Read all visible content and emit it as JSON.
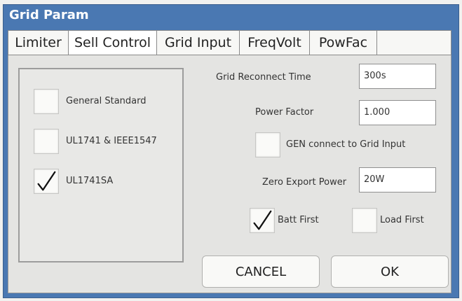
{
  "window": {
    "title": "Grid Param"
  },
  "tabs": [
    {
      "label": "Limiter",
      "active": false
    },
    {
      "label": "Sell Control",
      "active": true
    },
    {
      "label": "Grid Input",
      "active": false
    },
    {
      "label": "FreqVolt",
      "active": false
    },
    {
      "label": "PowFac",
      "active": false
    }
  ],
  "standards": [
    {
      "label": "General Standard",
      "checked": false
    },
    {
      "label": "UL1741 & IEEE1547",
      "checked": false
    },
    {
      "label": "UL1741SA",
      "checked": true
    }
  ],
  "settings": {
    "reconnect_label": "Grid Reconnect Time",
    "reconnect_value": "300s",
    "power_factor_label": "Power Factor",
    "power_factor_value": "1.000",
    "gen_connect_label": "GEN connect to Grid Input",
    "gen_connect_checked": false,
    "zero_export_label": "Zero Export Power",
    "zero_export_value": "20W",
    "batt_first_label": "Batt First",
    "batt_first_checked": true,
    "load_first_label": "Load First",
    "load_first_checked": false
  },
  "buttons": {
    "cancel": "CANCEL",
    "ok": "OK"
  },
  "colors": {
    "titlebar": "#4a78b2",
    "panel": "#e4e4e2",
    "tab_active": "#ffffff"
  }
}
